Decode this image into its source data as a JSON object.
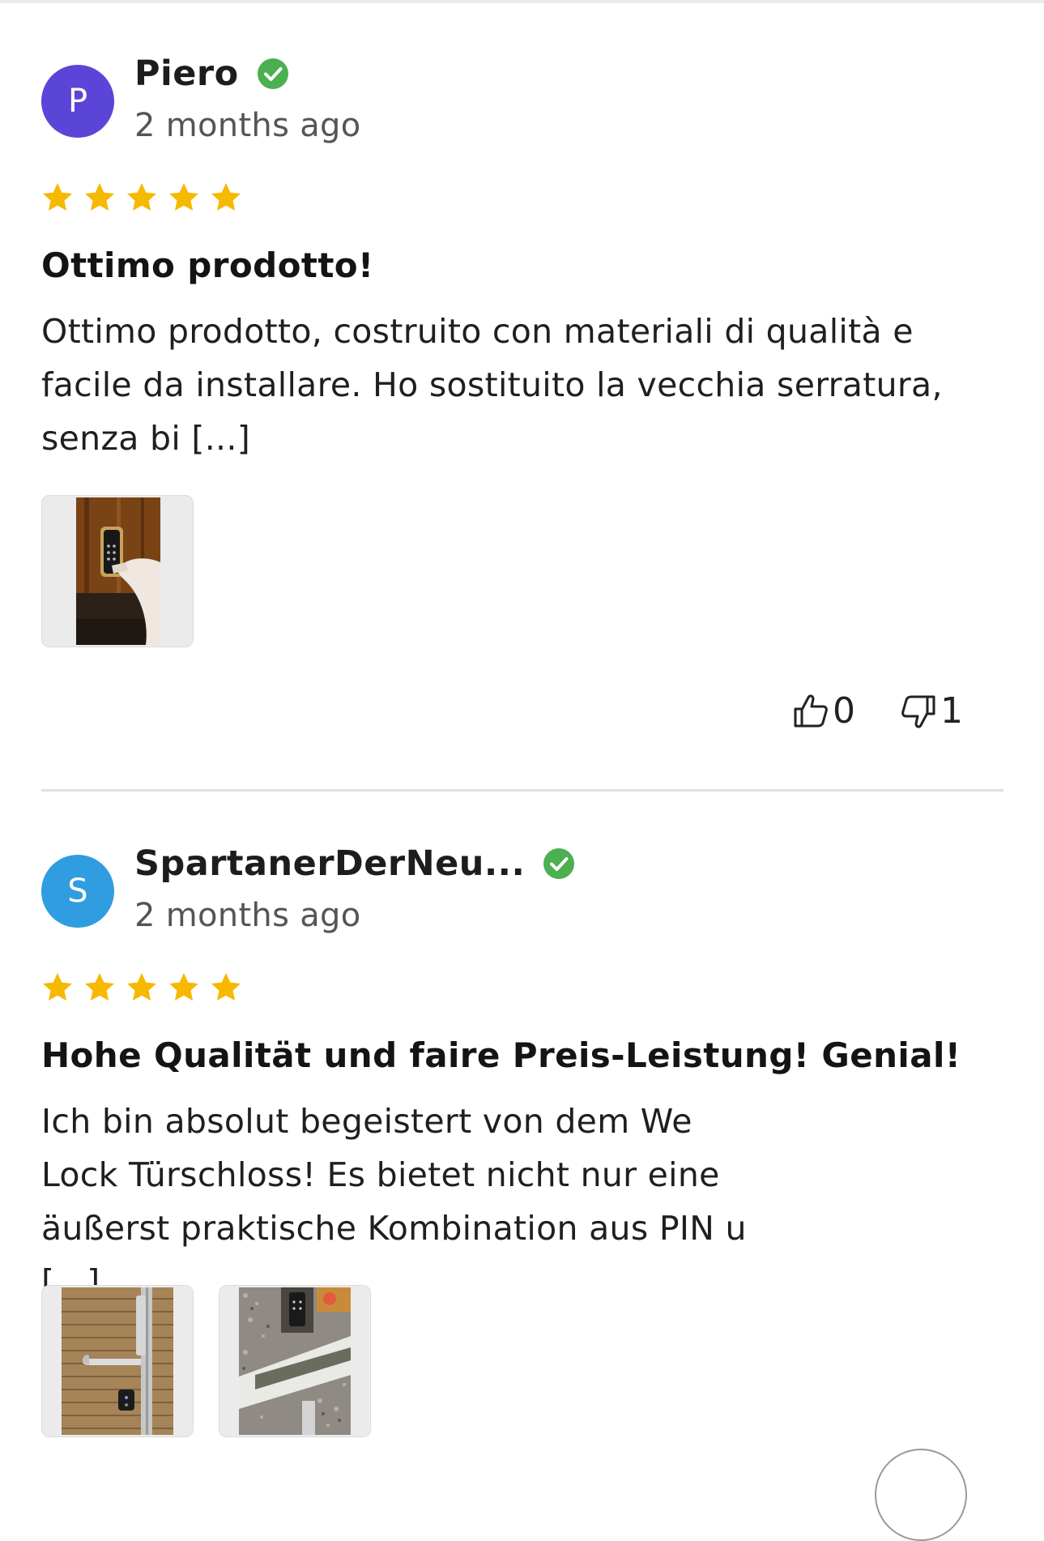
{
  "reviews": [
    {
      "avatar_letter": "P",
      "avatar_color": "#5b45d8",
      "name": "Piero",
      "time": "2 months ago",
      "rating": 5,
      "title": "Ottimo prodotto!",
      "body": "Ottimo prodotto, costruito con materiali di qualità e facile da installare. Ho sostituito la vecchia serratura, senza bi [...]",
      "photo_count": 1,
      "helpful_up": "0",
      "helpful_down": "1"
    },
    {
      "avatar_letter": "S",
      "avatar_color": "#2f9de0",
      "name": "SpartanerDerNeu...",
      "time": "2 months ago",
      "rating": 5,
      "title": "Hohe Qualität und faire Preis-Leistung! Genial!",
      "body": "Ich bin absolut begeistert von dem We Lock Türschloss! Es bietet nicht nur eine äußerst praktische Kombination aus PIN u [...]",
      "photo_count": 2
    }
  ],
  "colors": {
    "star": "#f7b800",
    "verified": "#4caf50",
    "divider": "#e2e2e2"
  },
  "icons": {
    "verified": "check-circle-icon",
    "star": "star-icon",
    "up": "thumbs-up-icon",
    "down": "thumbs-down-icon"
  }
}
